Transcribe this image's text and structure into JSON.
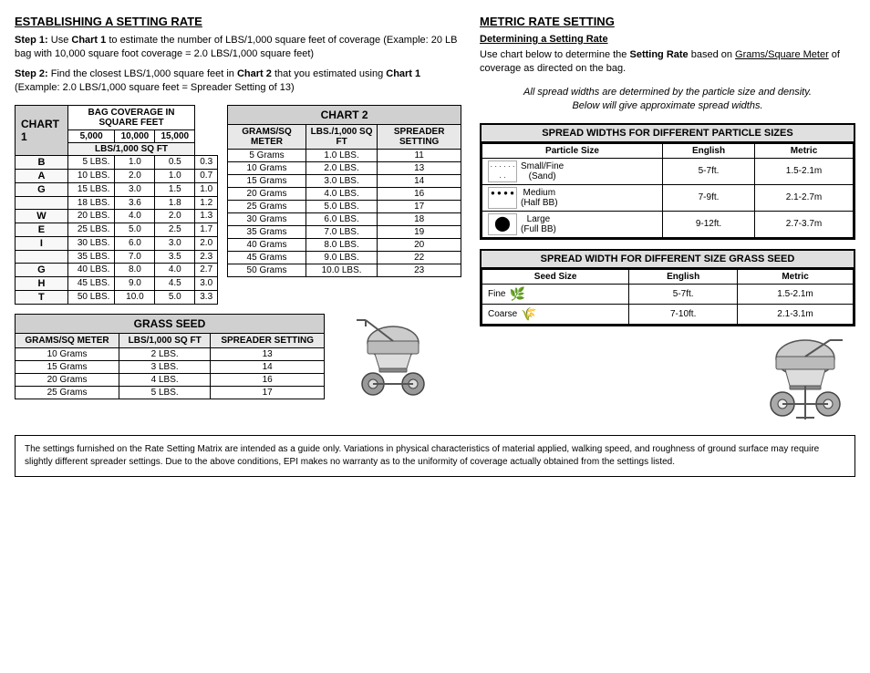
{
  "left": {
    "establishing_title": "ESTABLISHING A SETTING RATE",
    "step1_label": "Step 1:",
    "step1_text": "Use Chart 1 to estimate the number of LBS/1,000 square feet of coverage (Example: 20 LB bag with 10,000 square foot coverage = 2.0 LBS/1,000 square feet)",
    "step2_label": "Step 2:",
    "step2_text": "Find the closest LBS/1,000 square feet in Chart 2 that you estimated using Chart 1 (Example: 2.0 LBS/1,000 square feet = Spreader Setting of 13)",
    "chart1": {
      "title": "CHART 1",
      "bag_coverage_header": "BAG COVERAGE IN SQUARE FEET",
      "columns": [
        "5,000",
        "10,000",
        "15,000"
      ],
      "lbs_header": "LBS/1,000 SQ FT",
      "rows": [
        {
          "weight": "5 LBS.",
          "side": "B",
          "vals": [
            "1.0",
            "0.5",
            "0.3"
          ]
        },
        {
          "weight": "10 LBS.",
          "side": "A",
          "vals": [
            "2.0",
            "1.0",
            "0.7"
          ]
        },
        {
          "weight": "15 LBS.",
          "side": "G",
          "vals": [
            "3.0",
            "1.5",
            "1.0"
          ]
        },
        {
          "weight": "18 LBS.",
          "side": "",
          "vals": [
            "3.6",
            "1.8",
            "1.2"
          ]
        },
        {
          "weight": "20 LBS.",
          "side": "W",
          "vals": [
            "4.0",
            "2.0",
            "1.3"
          ]
        },
        {
          "weight": "25 LBS.",
          "side": "E",
          "vals": [
            "5.0",
            "2.5",
            "1.7"
          ]
        },
        {
          "weight": "30 LBS.",
          "side": "I",
          "vals": [
            "6.0",
            "3.0",
            "2.0"
          ]
        },
        {
          "weight": "35 LBS.",
          "side": "",
          "vals": [
            "7.0",
            "3.5",
            "2.3"
          ]
        },
        {
          "weight": "40 LBS.",
          "side": "G",
          "vals": [
            "8.0",
            "4.0",
            "2.7"
          ]
        },
        {
          "weight": "45 LBS.",
          "side": "H",
          "vals": [
            "9.0",
            "4.5",
            "3.0"
          ]
        },
        {
          "weight": "50 LBS.",
          "side": "T",
          "vals": [
            "10.0",
            "5.0",
            "3.3"
          ]
        }
      ]
    },
    "chart2": {
      "title": "CHART 2",
      "headers": [
        "GRAMS/SQ METER",
        "LBS./1,000 SQ FT",
        "SPREADER SETTING"
      ],
      "rows": [
        [
          "5 Grams",
          "1.0 LBS.",
          "11"
        ],
        [
          "10 Grams",
          "2.0 LBS.",
          "13"
        ],
        [
          "15 Grams",
          "3.0 LBS.",
          "14"
        ],
        [
          "20 Grams",
          "4.0 LBS.",
          "16"
        ],
        [
          "25 Grams",
          "5.0 LBS.",
          "17"
        ],
        [
          "30 Grams",
          "6.0 LBS.",
          "18"
        ],
        [
          "35 Grams",
          "7.0 LBS.",
          "19"
        ],
        [
          "40 Grams",
          "8.0 LBS.",
          "20"
        ],
        [
          "45 Grams",
          "9.0 LBS.",
          "22"
        ],
        [
          "50 Grams",
          "10.0 LBS.",
          "23"
        ]
      ]
    },
    "grass_seed": {
      "title": "GRASS SEED",
      "headers": [
        "GRAMS/SQ METER",
        "LBS/1,000 SQ FT",
        "SPREADER SETTING"
      ],
      "rows": [
        [
          "10 Grams",
          "2 LBS.",
          "13"
        ],
        [
          "15 Grams",
          "3 LBS.",
          "14"
        ],
        [
          "20 Grams",
          "4 LBS.",
          "16"
        ],
        [
          "25 Grams",
          "5 LBS.",
          "17"
        ]
      ]
    }
  },
  "right": {
    "metric_title": "METRIC RATE SETTING",
    "determining_title": "Determining a Setting Rate",
    "intro_text": "Use chart below to determine the Setting Rate based on Grams/Square Meter of coverage as directed on the bag.",
    "italic_note": "All spread widths are determined by the particle size and density.\nBelow will give approximate spread widths.",
    "spread_widths": {
      "title": "SPREAD WIDTHS FOR DIFFERENT PARTICLE SIZES",
      "headers": [
        "Particle Size",
        "English",
        "Metric"
      ],
      "rows": [
        {
          "name": "Small/Fine\n(Sand)",
          "icon": "dots",
          "english": "5-7ft.",
          "metric": "1.5-2.1m"
        },
        {
          "name": "Medium\n(Half BB)",
          "icon": "medium",
          "english": "7-9ft.",
          "metric": "2.1-2.7m"
        },
        {
          "name": "Large\n(Full BB)",
          "icon": "large",
          "english": "9-12ft.",
          "metric": "2.7-3.7m"
        }
      ]
    },
    "spread_seed": {
      "title": "SPREAD WIDTH FOR DIFFERENT SIZE GRASS SEED",
      "headers": [
        "Seed Size",
        "English",
        "Metric"
      ],
      "rows": [
        {
          "name": "Fine",
          "icon": "fine-seed",
          "english": "5-7ft.",
          "metric": "1.5-2.1m"
        },
        {
          "name": "Coarse",
          "icon": "coarse-seed",
          "english": "7-10ft.",
          "metric": "2.1-3.1m"
        }
      ]
    }
  },
  "disclaimer": "The settings furnished on the Rate Setting Matrix are intended as a guide only.  Variations in physical characteristics of material applied, walking speed, and roughness of ground surface may require slightly different spreader settings. Due to the above conditions, EPI makes no warranty as to the uniformity of coverage actually obtained from the settings listed."
}
